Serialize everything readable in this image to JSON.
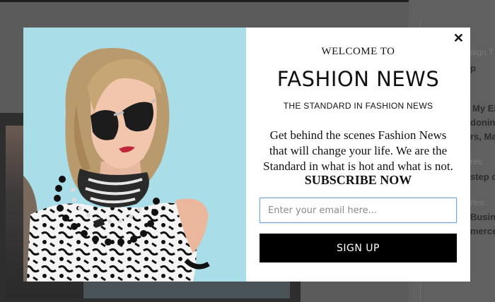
{
  "background": {
    "sidebar_fragments": [
      {
        "text": "aign T",
        "style": "muted"
      },
      {
        "text": "p",
        "style": "bold"
      },
      {
        "text": "My En",
        "style": "bold"
      },
      {
        "text": "doning",
        "style": "bold"
      },
      {
        "text": "rs, Ma",
        "style": "bold"
      },
      {
        "text": "res:",
        "style": "muted"
      },
      {
        "text": "step ca",
        "style": "bold"
      },
      {
        "text": "ries:",
        "style": "muted"
      },
      {
        "text": "Busin",
        "style": "bold"
      },
      {
        "text": "merce",
        "style": "bold"
      }
    ]
  },
  "popup": {
    "close_label": "✕",
    "welcome": "WELCOME TO",
    "brand": "FASHION NEWS",
    "tagline": "THE STANDARD IN FASHION NEWS",
    "description": "Get behind the scenes Fashion News that will change your life. We are the Standard in what is hot and what is not.",
    "cta": "SUBSCRIBE NOW",
    "email_placeholder": "Enter your email here...",
    "email_value": "",
    "signup_label": "SIGN UP",
    "colors": {
      "photo_background": "#a9dde8",
      "button": "#000000",
      "input_border": "#7aa3d6"
    }
  }
}
